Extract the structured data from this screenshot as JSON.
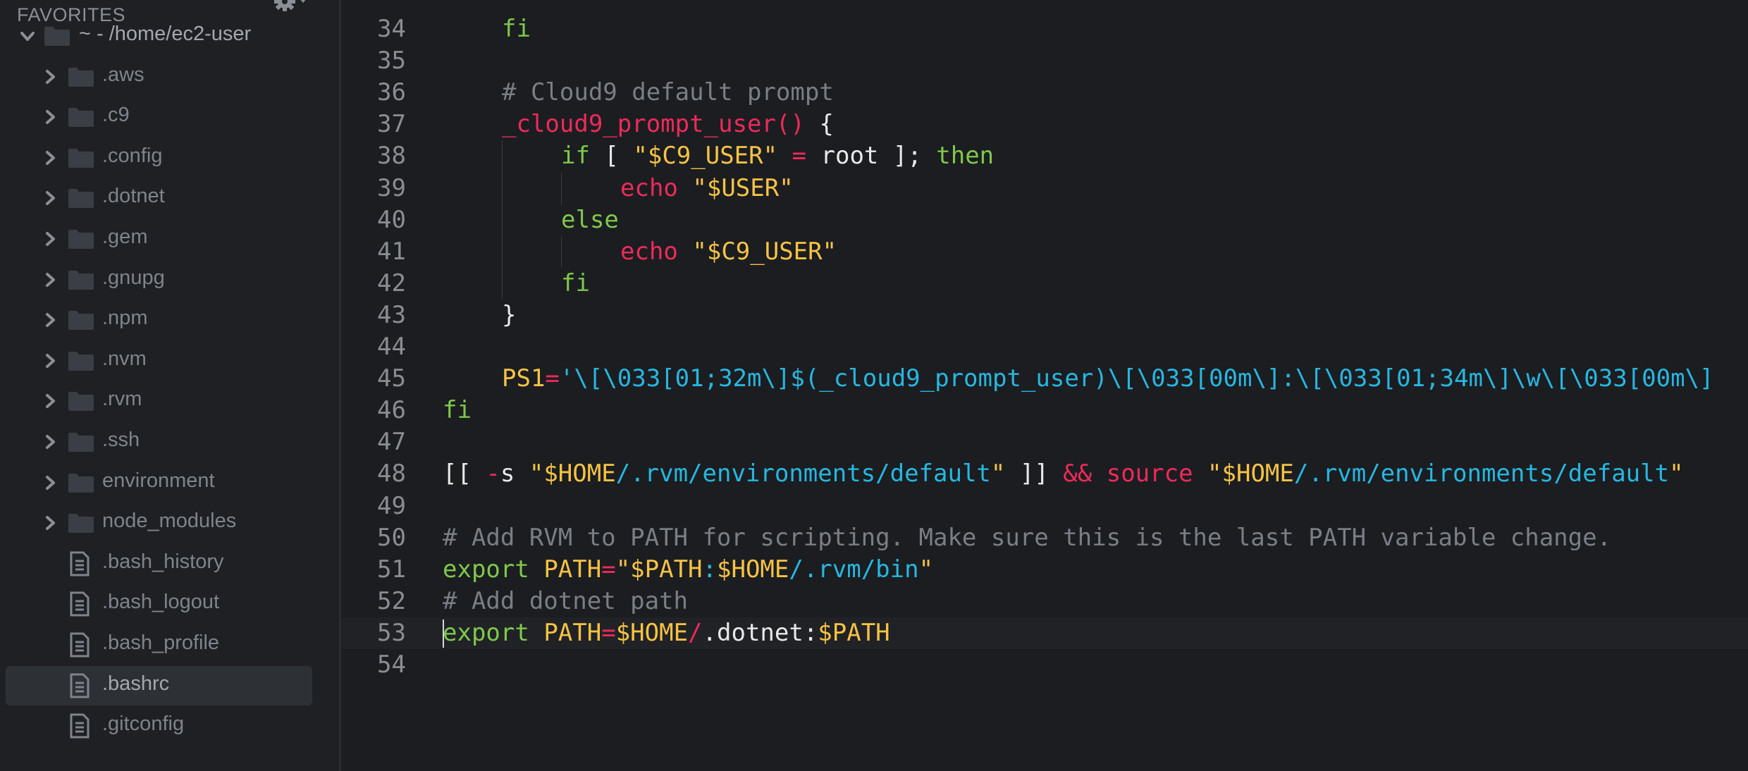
{
  "sidebar": {
    "header": "FAVORITES",
    "root": "~ - /home/ec2-user",
    "folders": [
      ".aws",
      ".c9",
      ".config",
      ".dotnet",
      ".gem",
      ".gnupg",
      ".npm",
      ".nvm",
      ".rvm",
      ".ssh",
      "environment",
      "node_modules"
    ],
    "files": [
      ".bash_history",
      ".bash_logout",
      ".bash_profile",
      ".bashrc",
      ".gitconfig"
    ],
    "selected_file": ".bashrc"
  },
  "editor": {
    "active_line": "53",
    "lines": [
      {
        "n": "34",
        "t": [
          {
            "c": "kw",
            "v": "fi"
          }
        ]
      },
      {
        "n": "35",
        "t": []
      },
      {
        "n": "36",
        "t": [
          {
            "c": "cmt",
            "v": "# Cloud9 default prompt"
          }
        ]
      },
      {
        "n": "37",
        "t": [
          {
            "c": "fn",
            "v": "_cloud9_prompt_user()"
          },
          {
            "c": "pl",
            "v": " {"
          }
        ]
      },
      {
        "n": "38",
        "t": [
          {
            "c": "kw",
            "v": "if"
          },
          {
            "c": "pl",
            "v": " [ "
          },
          {
            "c": "str",
            "v": "\"$C9_USER\""
          },
          {
            "c": "op",
            "v": " = "
          },
          {
            "c": "pl",
            "v": "root ]; "
          },
          {
            "c": "kw",
            "v": "then"
          }
        ]
      },
      {
        "n": "39",
        "t": [
          {
            "c": "fn",
            "v": "echo"
          },
          {
            "c": "pl",
            "v": " "
          },
          {
            "c": "str",
            "v": "\"$USER\""
          }
        ]
      },
      {
        "n": "40",
        "t": [
          {
            "c": "kw",
            "v": "else"
          }
        ]
      },
      {
        "n": "41",
        "t": [
          {
            "c": "fn",
            "v": "echo"
          },
          {
            "c": "pl",
            "v": " "
          },
          {
            "c": "str",
            "v": "\"$C9_USER\""
          }
        ]
      },
      {
        "n": "42",
        "t": [
          {
            "c": "kw",
            "v": "fi"
          }
        ]
      },
      {
        "n": "43",
        "t": [
          {
            "c": "pl",
            "v": "}"
          }
        ]
      },
      {
        "n": "44",
        "t": []
      },
      {
        "n": "45",
        "t": [
          {
            "c": "var",
            "v": "PS1"
          },
          {
            "c": "op",
            "v": "="
          },
          {
            "c": "cy",
            "v": "'\\[\\033[01;32m\\]$(_cloud9_prompt_user)\\[\\033[00m\\]:\\[\\033[01;34m\\]\\w\\[\\033[00m\\]"
          }
        ]
      },
      {
        "n": "46",
        "t": [
          {
            "c": "kw",
            "v": "fi"
          }
        ]
      },
      {
        "n": "47",
        "t": []
      },
      {
        "n": "48",
        "t": [
          {
            "c": "pl",
            "v": "[[ "
          },
          {
            "c": "op",
            "v": "-"
          },
          {
            "c": "pl",
            "v": "s "
          },
          {
            "c": "str",
            "v": "\"$HOME"
          },
          {
            "c": "cy",
            "v": "/.rvm/environments/default"
          },
          {
            "c": "str",
            "v": "\""
          },
          {
            "c": "pl",
            "v": " ]] "
          },
          {
            "c": "op",
            "v": "&&"
          },
          {
            "c": "pl",
            "v": " "
          },
          {
            "c": "fn",
            "v": "source"
          },
          {
            "c": "pl",
            "v": " "
          },
          {
            "c": "str",
            "v": "\"$HOME"
          },
          {
            "c": "cy",
            "v": "/.rvm/environments/default"
          },
          {
            "c": "str",
            "v": "\""
          }
        ]
      },
      {
        "n": "49",
        "t": []
      },
      {
        "n": "50",
        "t": [
          {
            "c": "cmt",
            "v": "# Add RVM to PATH for scripting. Make sure this is the last PATH variable change."
          }
        ]
      },
      {
        "n": "51",
        "t": [
          {
            "c": "kw",
            "v": "export"
          },
          {
            "c": "pl",
            "v": " "
          },
          {
            "c": "var",
            "v": "PATH"
          },
          {
            "c": "op",
            "v": "="
          },
          {
            "c": "str",
            "v": "\"$PATH"
          },
          {
            "c": "cy",
            "v": ":"
          },
          {
            "c": "str",
            "v": "$HOME"
          },
          {
            "c": "cy",
            "v": "/.rvm/bin"
          },
          {
            "c": "str",
            "v": "\""
          }
        ]
      },
      {
        "n": "52",
        "t": [
          {
            "c": "cmt",
            "v": "# Add dotnet path"
          }
        ]
      },
      {
        "n": "53",
        "t": [
          {
            "c": "kw",
            "v": "export"
          },
          {
            "c": "pl",
            "v": " "
          },
          {
            "c": "var",
            "v": "PATH"
          },
          {
            "c": "op",
            "v": "="
          },
          {
            "c": "str",
            "v": "$HOME"
          },
          {
            "c": "op",
            "v": "/"
          },
          {
            "c": "pl",
            "v": ".dotnet:"
          },
          {
            "c": "str",
            "v": "$PATH"
          }
        ]
      },
      {
        "n": "54",
        "t": []
      }
    ]
  },
  "colors": {
    "background": "#1b1d21",
    "keyword": "#7fc84a",
    "function": "#ef2a5a",
    "string": "#f6c344",
    "path": "#27b7e0",
    "comment": "#7a7e85"
  }
}
